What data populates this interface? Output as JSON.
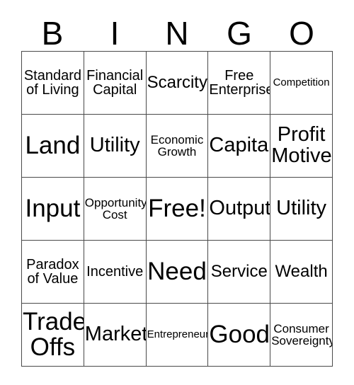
{
  "card": {
    "title": "BINGO",
    "header_letters": [
      "B",
      "I",
      "N",
      "G",
      "O"
    ],
    "border_color": "#4a4a4a",
    "background_color": "#ffffff",
    "text_color": "#000000",
    "rows": 5,
    "columns": 5,
    "free_space_label": "Free!",
    "cells": [
      [
        {
          "label": "Standard\nof Living",
          "size": "sm"
        },
        {
          "label": "Financial\nCapital",
          "size": "sm"
        },
        {
          "label": "Scarcity",
          "size": "md"
        },
        {
          "label": "Free\nEnterprise",
          "size": "sm"
        },
        {
          "label": "Competition",
          "size": "xxs"
        }
      ],
      [
        {
          "label": "Land",
          "size": "xl"
        },
        {
          "label": "Utility",
          "size": "lg"
        },
        {
          "label": "Economic\nGrowth",
          "size": "xs"
        },
        {
          "label": "Capital",
          "size": "lg"
        },
        {
          "label": "Profit\nMotive",
          "size": "lg"
        }
      ],
      [
        {
          "label": "Input",
          "size": "xl"
        },
        {
          "label": "Opportunity\nCost",
          "size": "xs"
        },
        {
          "label": "Free!",
          "size": "xl"
        },
        {
          "label": "Output",
          "size": "lg"
        },
        {
          "label": "Utility",
          "size": "lg"
        }
      ],
      [
        {
          "label": "Paradox\nof Value",
          "size": "sm"
        },
        {
          "label": "Incentive",
          "size": "sm"
        },
        {
          "label": "Need",
          "size": "xl"
        },
        {
          "label": "Service",
          "size": "md"
        },
        {
          "label": "Wealth",
          "size": "md"
        }
      ],
      [
        {
          "label": "Trade-\nOffs",
          "size": "xl"
        },
        {
          "label": "Market",
          "size": "lg"
        },
        {
          "label": "Entrepreneur",
          "size": "xxs"
        },
        {
          "label": "Good",
          "size": "xl"
        },
        {
          "label": "Consumer\nSovereignty",
          "size": "xs"
        }
      ]
    ]
  }
}
